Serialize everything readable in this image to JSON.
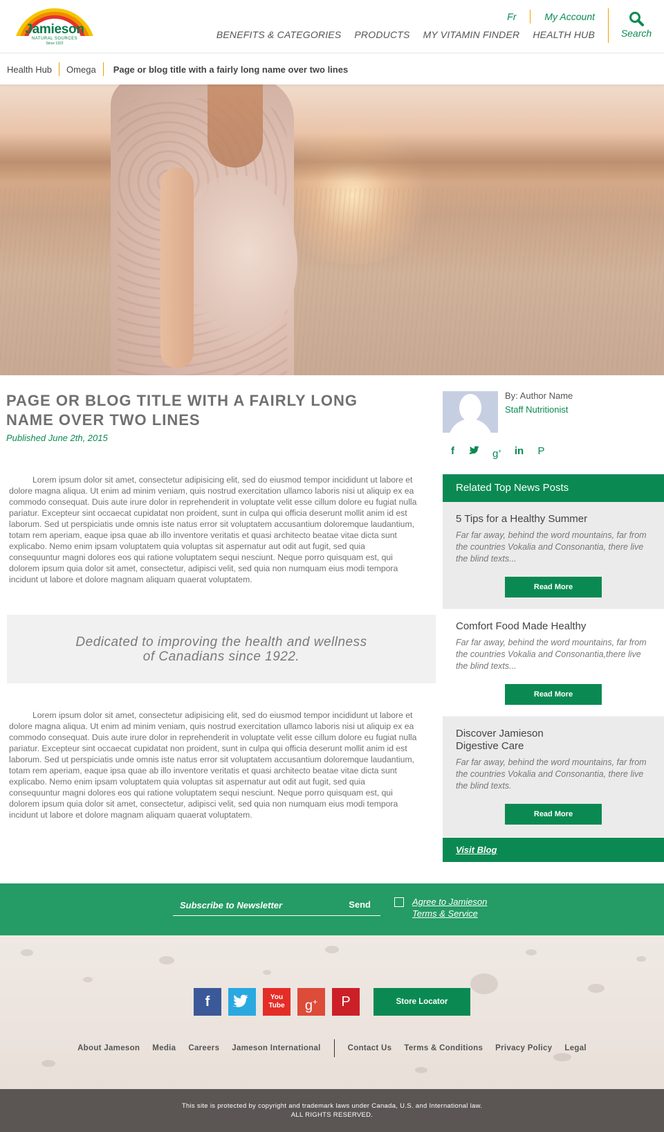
{
  "brand": {
    "name": "Jamieson",
    "tagline": "NATURAL SOURCES",
    "since": "Since 1922",
    "colors": {
      "primary": "#0a8a52",
      "accent": "#f2a000",
      "newsletter": "#259b65",
      "footer_bar": "#5b5654"
    }
  },
  "header": {
    "lang_link": "Fr",
    "account_link": "My Account",
    "nav": [
      "BENEFITS & CATEGORIES",
      "PRODUCTS",
      "MY VITAMIN FINDER",
      "HEALTH HUB"
    ],
    "search_label": "Search",
    "search_icon": "search-icon"
  },
  "breadcrumb": {
    "items": [
      "Health Hub",
      "Omega"
    ],
    "current": "Page or blog title with a fairly long name over two lines"
  },
  "article": {
    "title": "PAGE OR BLOG TITLE WITH A FAIRLY LONG NAME OVER TWO LINES",
    "published": "Published June 2th, 2015",
    "paragraph_1": "Lorem ipsum dolor sit amet, consectetur adipisicing elit, sed do eiusmod tempor incididunt ut labore et dolore magna aliqua. Ut enim ad minim veniam, quis nostrud exercitation ullamco laboris nisi ut aliquip ex ea commodo consequat. Duis aute irure dolor in reprehenderit in voluptate velit esse cillum dolore eu fugiat nulla pariatur. Excepteur sint occaecat cupidatat non proident, sunt in culpa qui officia deserunt mollit anim id est laborum. Sed ut perspiciatis unde omnis iste natus error sit voluptatem accusantium doloremque laudantium, totam rem aperiam, eaque ipsa quae ab illo inventore veritatis et quasi architecto beatae vitae dicta sunt explicabo. Nemo enim ipsam voluptatem quia voluptas sit aspernatur aut odit aut fugit, sed quia consequuntur magni dolores eos qui ratione voluptatem sequi nesciunt. Neque porro quisquam est, qui dolorem ipsum quia dolor sit amet, consectetur, adipisci velit, sed quia non numquam eius modi tempora incidunt ut labore et dolore magnam aliquam quaerat voluptatem.",
    "quote": "Dedicated to improving the health and wellness of Canadians since 1922.",
    "paragraph_2": "Lorem ipsum dolor sit amet, consectetur adipisicing elit, sed do eiusmod tempor incididunt ut labore et dolore magna aliqua. Ut enim ad minim veniam, quis nostrud exercitation ullamco laboris nisi ut aliquip ex ea commodo consequat. Duis aute irure dolor in reprehenderit in voluptate velit esse cillum dolore eu fugiat nulla pariatur. Excepteur sint occaecat cupidatat non proident, sunt in culpa qui officia deserunt mollit anim id est laborum. Sed ut perspiciatis unde omnis iste natus error sit voluptatem accusantium doloremque laudantium, totam rem aperiam, eaque ipsa quae ab illo inventore veritatis et quasi architecto beatae vitae dicta sunt explicabo. Nemo enim ipsam voluptatem quia voluptas sit aspernatur aut odit aut fugit, sed quia consequuntur magni dolores eos qui ratione voluptatem sequi nesciunt. Neque porro quisquam est, qui dolorem ipsum quia dolor sit amet, consectetur, adipisci velit, sed quia non numquam eius modi tempora incidunt ut labore et dolore magnam aliquam quaerat voluptatem."
  },
  "author": {
    "name": "By: Author Name",
    "role": "Staff Nutritionist",
    "share_icons": [
      "facebook-icon",
      "twitter-icon",
      "google-plus-icon",
      "linkedin-icon",
      "pinterest-icon"
    ]
  },
  "related": {
    "heading": "Related Top News Posts",
    "posts": [
      {
        "title": "5 Tips for a Healthy Summer",
        "excerpt": "Far far away, behind the word mountains, far from the countries Vokalia and Consonantia, there live the blind texts...",
        "button": "Read More"
      },
      {
        "title": "Comfort Food Made Healthy",
        "excerpt": "Far far away, behind the word mountains, far from the countries Vokalia and Consonantia,there live the blind texts...",
        "button": "Read More"
      },
      {
        "title": "Discover Jamieson Digestive Care",
        "excerpt": "Far far away, behind the word mountains, far  from the countries Vokalia and Consonantia, there live the blind texts.",
        "button": "Read More"
      }
    ],
    "visit_blog": "Visit Blog"
  },
  "newsletter": {
    "placeholder": "Subscribe to Newsletter",
    "send": "Send",
    "terms_line1": "Agree to Jamieson",
    "terms_line2": "Terms & Service"
  },
  "footer": {
    "social": [
      {
        "icon": "facebook-icon",
        "glyph": "f",
        "color": "#3b5998"
      },
      {
        "icon": "twitter-icon",
        "glyph": "t",
        "color": "#2aa9e0"
      },
      {
        "icon": "youtube-icon",
        "glyph": "You\nTube",
        "color": "#e52d27"
      },
      {
        "icon": "google-plus-icon",
        "glyph": "g+",
        "color": "#dd4b39"
      },
      {
        "icon": "pinterest-icon",
        "glyph": "P",
        "color": "#cb2027"
      }
    ],
    "store_locator": "Store Locator",
    "links_left": [
      "About Jameson",
      "Media",
      "Careers",
      "Jameson International"
    ],
    "links_right": [
      "Contact Us",
      "Terms & Conditions",
      "Privacy Policy",
      "Legal"
    ],
    "copyright_1": "This site is protected by copyright and trademark laws under Canada, U.S. and International law.",
    "copyright_2": "ALL RIGHTS RESERVED."
  }
}
